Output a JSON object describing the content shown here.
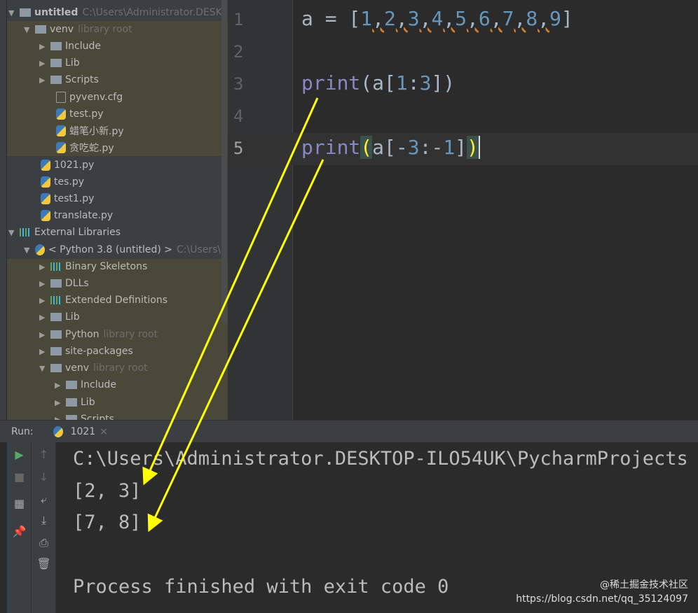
{
  "tree": {
    "project": {
      "name": "untitled",
      "path": "C:\\Users\\Administrator.DESK"
    },
    "venv": {
      "name": "venv",
      "tag": "library root",
      "children": [
        "Include",
        "Lib",
        "Scripts"
      ],
      "files": [
        "pyvenv.cfg",
        "test.py",
        "蜡笔小新.py",
        "贪吃蛇.py"
      ]
    },
    "root_files": [
      "1021.py",
      "tes.py",
      "test1.py",
      "translate.py"
    ],
    "external": {
      "label": "External Libraries",
      "sdk": "< Python 3.8 (untitled) >",
      "sdk_path": "C:\\Users\\",
      "items": [
        "Binary Skeletons",
        "DLLs",
        "Extended Definitions",
        "Lib",
        "Python",
        "site-packages",
        "venv"
      ],
      "python_tag": "library root",
      "venv_tag": "library root",
      "venv_children": [
        "Include",
        "Lib",
        "Scripts"
      ]
    }
  },
  "editor": {
    "line_numbers": [
      "1",
      "2",
      "3",
      "4",
      "5"
    ]
  },
  "run": {
    "label": "Run:",
    "tab": "1021",
    "close": "×"
  },
  "console": {
    "lines": [
      "C:\\Users\\Administrator.DESKTOP-ILO54UK\\PycharmProjects",
      "[2, 3]",
      "[7, 8]",
      "Process finished with exit code 0"
    ]
  },
  "watermark": {
    "line1": "@稀土掘金技术社区",
    "line2": "https://blog.csdn.net/qq_35124097"
  },
  "colors": {
    "annotation": "#ffff00"
  }
}
